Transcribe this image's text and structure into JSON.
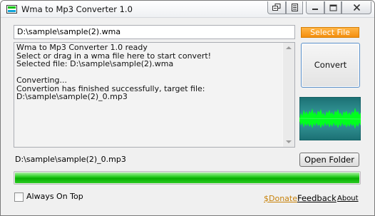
{
  "window": {
    "title": "Wma to Mp3 Converter 1.0"
  },
  "titlebar_buttons": [
    {
      "icon": "restore-icon"
    },
    {
      "icon": "pin-icon"
    },
    {
      "icon": "minimize-icon"
    },
    {
      "icon": "maximize-icon"
    },
    {
      "icon": "close-icon"
    }
  ],
  "source": {
    "path": "D:\\sample\\sample(2).wma",
    "select_label": "Select File"
  },
  "log": {
    "lines": [
      "Wma to Mp3 Converter 1.0 ready",
      "Select or drag in a wma file here to start convert!",
      "Selected file: D:\\sample\\sample(2).wma",
      "",
      "Converting...",
      "Convertion has finished successfully, target file:",
      "D:\\sample\\sample(2)_0.mp3"
    ]
  },
  "convert_label": "Convert",
  "target": {
    "path": "D:\\sample\\sample(2)_0.mp3",
    "open_label": "Open Folder"
  },
  "progress": {
    "fraction": 1.0
  },
  "options": {
    "always_on_top_label": "Always On Top",
    "always_on_top_checked": false
  },
  "links": {
    "donate": "$Donate",
    "feedback": "Feedback",
    "about": "About"
  },
  "colors": {
    "accent_orange": "#f48e0e",
    "progress_green": "#06b000",
    "wave_green": "#00ff1e",
    "wave_bg": "#2a8a8a",
    "donate_link": "#c8820a"
  }
}
